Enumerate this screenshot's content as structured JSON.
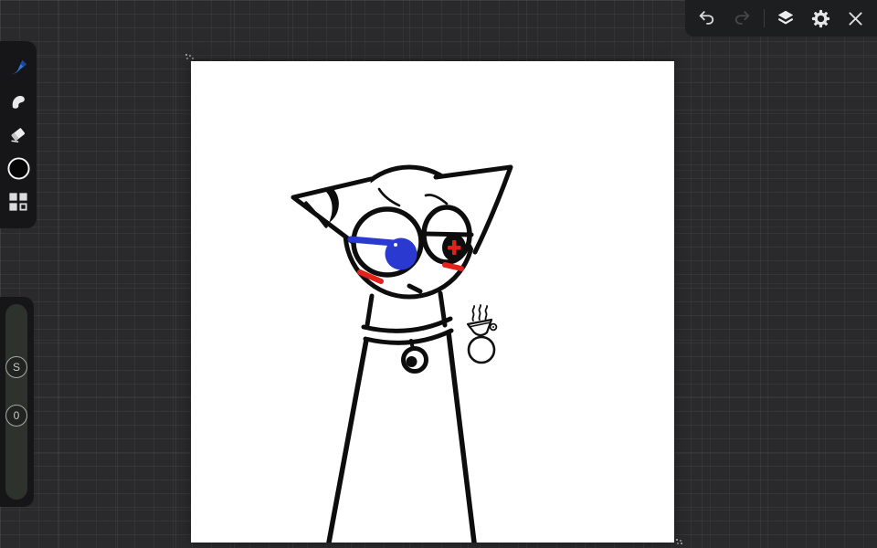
{
  "topbar": {
    "items": [
      {
        "id": "undo",
        "icon": "undo-icon",
        "enabled": true
      },
      {
        "id": "redo",
        "icon": "redo-icon",
        "enabled": false
      },
      {
        "id": "layers",
        "icon": "layers-icon",
        "enabled": true
      },
      {
        "id": "settings",
        "icon": "gear-icon",
        "enabled": true
      },
      {
        "id": "close",
        "icon": "close-icon",
        "enabled": true
      }
    ]
  },
  "tool_panel": {
    "active_accent": "#2f7de2",
    "items": [
      {
        "id": "paint-brush",
        "icon": "paintbrush-icon",
        "active": true
      },
      {
        "id": "smudge-brush",
        "icon": "smudge-brush-icon",
        "active": false
      },
      {
        "id": "eraser",
        "icon": "eraser-icon",
        "active": false
      },
      {
        "id": "current-color",
        "icon": "color-circle-icon",
        "value": "#000000"
      },
      {
        "id": "swatch-grid",
        "icon": "swatch-grid-icon",
        "active": false
      }
    ]
  },
  "slider_panel": {
    "handles": [
      {
        "label": "S"
      },
      {
        "label": "0"
      }
    ]
  },
  "canvas": {
    "background": "#ffffff",
    "artwork": {
      "ink_color": "#0d0d0d",
      "iris_color": "#2a3ad0",
      "accent_red": "#dd221c"
    }
  }
}
